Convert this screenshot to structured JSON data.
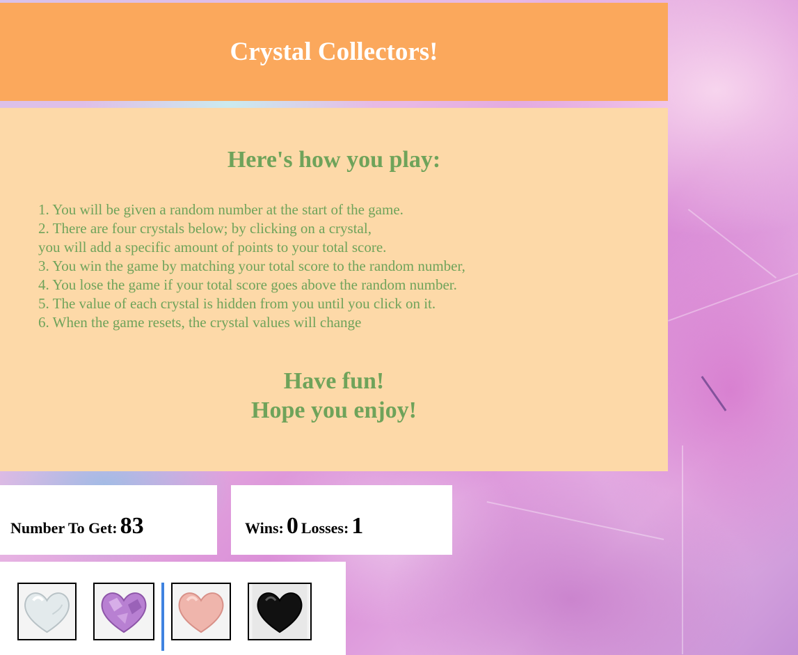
{
  "header": {
    "title": "Crystal Collectors!"
  },
  "instructions": {
    "heading": "Here's how you play:",
    "rules": [
      "1. You will be given a random number at the start of the game.",
      "2. There are four crystals below; by clicking on a crystal,",
      "you will add a specific amount of points to your total score.",
      "3. You win the game by matching your total score to the random number,",
      "4. You lose the game if your total score goes above the random number.",
      "5. The value of each crystal is hidden from you until you click on it.",
      "6. When the game resets, the crystal values will change"
    ],
    "fun_line1": "Have fun!",
    "fun_line2": "Hope you enjoy!"
  },
  "target": {
    "label": "Number To Get:",
    "value": "83"
  },
  "score": {
    "wins_label": "Wins:",
    "wins": "0",
    "losses_label": "Losses:",
    "losses": "1"
  },
  "crystals": [
    {
      "name": "clear-quartz-heart",
      "color": "#e8eef0"
    },
    {
      "name": "amethyst-heart",
      "color": "#c08ad6"
    },
    {
      "name": "rose-quartz-heart",
      "color": "#f0b6b0"
    },
    {
      "name": "obsidian-heart",
      "color": "#111111"
    }
  ],
  "colors": {
    "header_bg": "#fba85c",
    "panel_bg": "#fdd9a8",
    "text_green": "#6fa35a",
    "divider": "#3f83e0"
  }
}
